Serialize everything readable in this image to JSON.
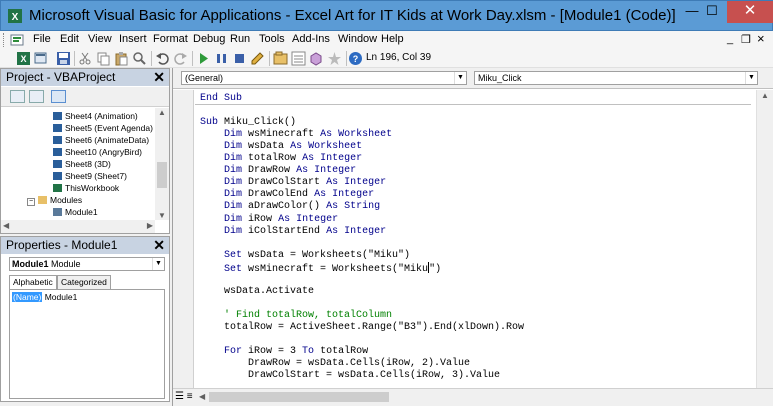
{
  "window": {
    "title": "Microsoft Visual Basic for Applications - Excel Art for IT Kids at Work Day.xlsm - [Module1 (Code)]",
    "minimize": "—",
    "restore": "☐",
    "close": "✕"
  },
  "menubar": {
    "items": [
      "File",
      "Edit",
      "View",
      "Insert",
      "Format",
      "Debug",
      "Run",
      "Tools",
      "Add-Ins",
      "Window",
      "Help"
    ],
    "mdi_minimize": "_",
    "mdi_restore": "❐",
    "mdi_close": "×"
  },
  "toolbar": {
    "position": "Ln 196, Col 39"
  },
  "project_pane": {
    "title": "Project - VBAProject",
    "close": "✕",
    "tree": [
      {
        "label": "Sheet4 (Animation)",
        "type": "sheet"
      },
      {
        "label": "Sheet5 (Event Agenda)",
        "type": "sheet"
      },
      {
        "label": "Sheet6 (AnimateData)",
        "type": "sheet"
      },
      {
        "label": "Sheet10 (AngryBird)",
        "type": "sheet"
      },
      {
        "label": "Sheet8 (3D)",
        "type": "sheet"
      },
      {
        "label": "Sheet9 (Sheet7)",
        "type": "sheet"
      },
      {
        "label": "ThisWorkbook",
        "type": "workbook"
      },
      {
        "label": "Modules",
        "type": "folder"
      },
      {
        "label": "Module1",
        "type": "module"
      }
    ]
  },
  "properties_pane": {
    "title": "Properties - Module1",
    "close": "✕",
    "object_name": "Module1",
    "object_type": "Module",
    "tabs": [
      "Alphabetic",
      "Categorized"
    ],
    "prop_name": "(Name)",
    "prop_value": "Module1"
  },
  "code_window": {
    "object_combo": "(General)",
    "proc_combo": "Miku_Click",
    "lines": [
      {
        "text": "End Sub",
        "type": "kw"
      },
      {
        "text": "",
        "type": "plain"
      },
      {
        "text": "Sub Miku_Click()",
        "type": "mixed",
        "kw": "Sub",
        "rest": " Miku_Click()"
      },
      {
        "text": "    Dim wsMinecraft As Worksheet",
        "type": "dim",
        "name": "wsMinecraft",
        "typename": "Worksheet"
      },
      {
        "text": "    Dim wsData As Worksheet",
        "type": "dim",
        "name": "wsData",
        "typename": "Worksheet"
      },
      {
        "text": "    Dim totalRow As Integer",
        "type": "dim",
        "name": "totalRow",
        "typename": "Integer"
      },
      {
        "text": "    Dim DrawRow As Integer",
        "type": "dim",
        "name": "DrawRow",
        "typename": "Integer"
      },
      {
        "text": "    Dim DrawColStart As Integer",
        "type": "dim",
        "name": "DrawColStart",
        "typename": "Integer"
      },
      {
        "text": "    Dim DrawColEnd As Integer",
        "type": "dim",
        "name": "DrawColEnd",
        "typename": "Integer"
      },
      {
        "text": "    Dim aDrawColor() As String",
        "type": "dim",
        "name": "aDrawColor()",
        "typename": "String"
      },
      {
        "text": "    Dim iRow As Integer",
        "type": "dim",
        "name": "iRow",
        "typename": "Integer"
      },
      {
        "text": "    Dim iColStartEnd As Integer",
        "type": "dim",
        "name": "iColStartEnd",
        "typename": "Integer"
      },
      {
        "text": "",
        "type": "plain"
      },
      {
        "text": "    Set wsData = Worksheets(\"Miku\")",
        "type": "set",
        "rest": " wsData = Worksheets(\"Miku\")"
      },
      {
        "text": "    Set wsMinecraft = Worksheets(\"Miku\")",
        "type": "set_caret",
        "rest_a": " wsMinecraft = Worksheets(\"Miku",
        "rest_b": "\")"
      },
      {
        "text": "",
        "type": "plain"
      },
      {
        "text": "    wsData.Activate",
        "type": "plain"
      },
      {
        "text": "",
        "type": "plain"
      },
      {
        "text": "    ' Find totalRow, totalColumn",
        "type": "cm"
      },
      {
        "text": "    totalRow = ActiveSheet.Range(\"B3\").End(xlDown).Row",
        "type": "plain"
      },
      {
        "text": "",
        "type": "plain"
      },
      {
        "text": "    For iRow = 3 To totalRow",
        "type": "for"
      },
      {
        "text": "        DrawRow = wsData.Cells(iRow, 2).Value",
        "type": "plain"
      },
      {
        "text": "        DrawColStart = wsData.Cells(iRow, 3).Value",
        "type": "plain"
      }
    ]
  }
}
